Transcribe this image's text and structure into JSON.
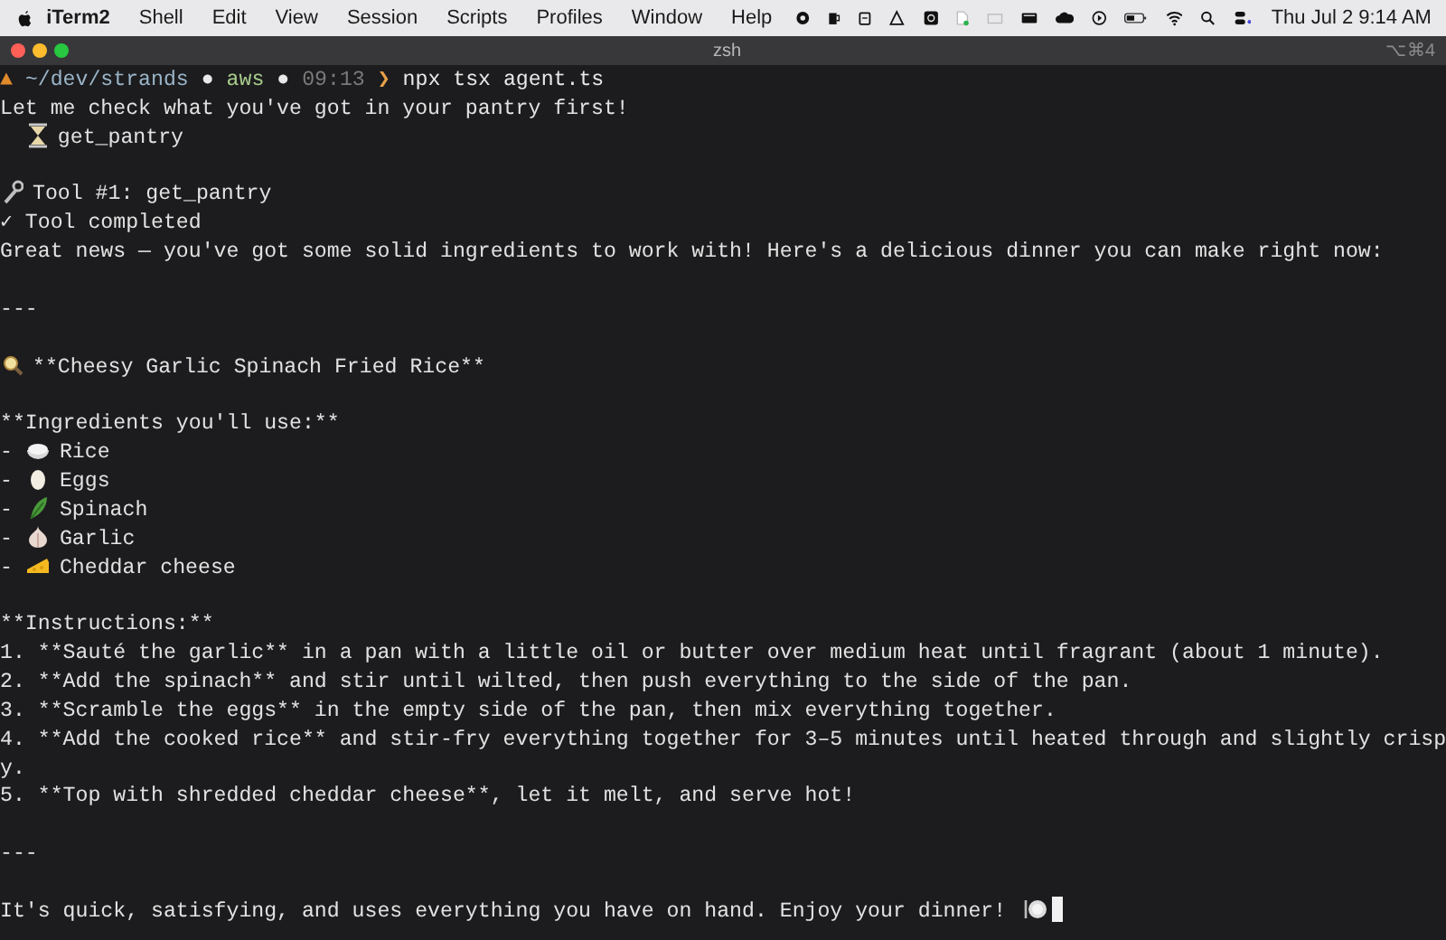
{
  "menubar": {
    "app": "iTerm2",
    "menus": [
      "Shell",
      "Edit",
      "View",
      "Session",
      "Scripts",
      "Profiles",
      "Window",
      "Help"
    ],
    "clock": "Thu Jul 2  9:14 AM"
  },
  "window": {
    "title": "zsh",
    "shortcut": "⌥⌘4"
  },
  "terminal": {
    "lines": [
      {
        "kind": "prompt",
        "glyph": "▲",
        "path": "~/dev/strands",
        "dot": "●",
        "context": "aws",
        "dot2": "●",
        "time": "09:13",
        "arrow": "❯",
        "command": "npx tsx agent.ts"
      },
      {
        "kind": "text",
        "text": "Let me check what you've got in your pantry first!"
      },
      {
        "kind": "tool-call",
        "text": "get_pantry"
      },
      {
        "kind": "blank"
      },
      {
        "kind": "tool",
        "text": "Tool #1: get_pantry"
      },
      {
        "kind": "text",
        "text": "✓ Tool completed"
      },
      {
        "kind": "text",
        "text": "Great news — you've got some solid ingredients to work with! Here's a delicious dinner you can make right now:"
      },
      {
        "kind": "blank"
      },
      {
        "kind": "text",
        "text": "---"
      },
      {
        "kind": "blank"
      },
      {
        "kind": "heading",
        "text": "**Cheesy Garlic Spinach Fried Rice**"
      },
      {
        "kind": "blank"
      },
      {
        "kind": "text",
        "text": "**Ingredients you'll use:**"
      },
      {
        "kind": "ingredient",
        "bullet": "-",
        "text": "Rice"
      },
      {
        "kind": "ingredient",
        "bullet": "-",
        "text": "Eggs"
      },
      {
        "kind": "ingredient",
        "bullet": "-",
        "text": "Spinach"
      },
      {
        "kind": "ingredient",
        "bullet": "-",
        "text": "Garlic"
      },
      {
        "kind": "ingredient",
        "bullet": "-",
        "text": "Cheddar cheese"
      },
      {
        "kind": "blank"
      },
      {
        "kind": "text",
        "text": "**Instructions:**"
      },
      {
        "kind": "text",
        "text": "1. **Sauté the garlic** in a pan with a little oil or butter over medium heat until fragrant (about 1 minute)."
      },
      {
        "kind": "text",
        "text": "2. **Add the spinach** and stir until wilted, then push everything to the side of the pan."
      },
      {
        "kind": "text",
        "text": "3. **Scramble the eggs** in the empty side of the pan, then mix everything together."
      },
      {
        "kind": "text",
        "text": "4. **Add the cooked rice** and stir-fry everything together for 3–5 minutes until heated through and slightly crisp"
      },
      {
        "kind": "text",
        "text": "y."
      },
      {
        "kind": "text",
        "text": "5. **Top with shredded cheddar cheese**, let it melt, and serve hot!"
      },
      {
        "kind": "blank"
      },
      {
        "kind": "text",
        "text": "---"
      },
      {
        "kind": "blank"
      },
      {
        "kind": "final",
        "text": "It's quick, satisfying, and uses everything you have on hand. Enjoy your dinner!"
      }
    ]
  }
}
